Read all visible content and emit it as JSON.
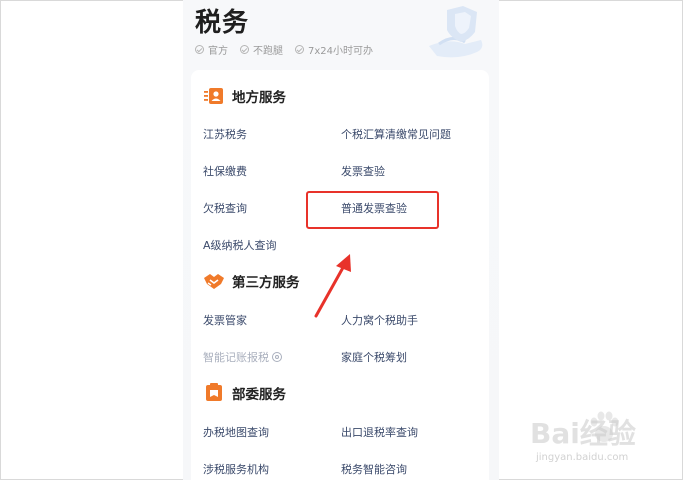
{
  "header": {
    "title": "税务",
    "tags": [
      "官方",
      "不跑腿",
      "7x24小时可办"
    ]
  },
  "sections": {
    "local": {
      "title": "地方服务",
      "items": [
        "江苏税务",
        "个税汇算清缴常见问题",
        "社保缴费",
        "发票查验",
        "欠税查询",
        "普通发票查验",
        "A级纳税人查询"
      ]
    },
    "third_party": {
      "title": "第三方服务",
      "items": [
        "发票管家",
        "人力窝个税助手",
        "智能记账报税",
        "家庭个税筹划"
      ]
    },
    "ministry": {
      "title": "部委服务",
      "items": [
        "办税地图查询",
        "出口退税率查询",
        "涉税服务机构",
        "税务智能咨询"
      ]
    }
  },
  "icons": {
    "local": "id-card-icon",
    "third_party": "handshake-icon",
    "ministry": "document-icon"
  },
  "colors": {
    "accent": "#f07a2a",
    "link": "#3b4a6b",
    "highlight": "#e8322a"
  },
  "watermark": {
    "brand": "Bai经验",
    "url": "jingyan.baidu.com"
  }
}
